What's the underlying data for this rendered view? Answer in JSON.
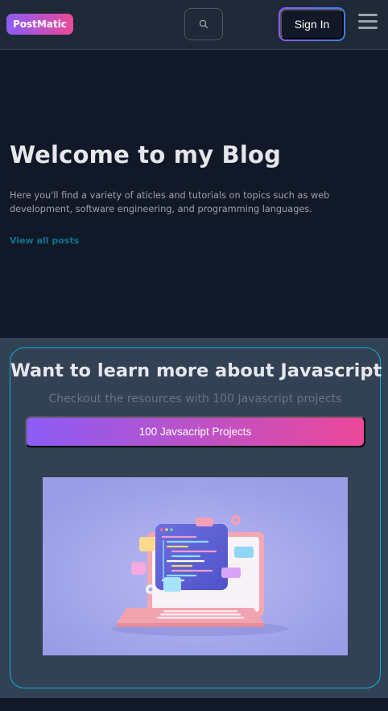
{
  "navbar": {
    "logo_text": "PostMatic",
    "search_icon": "search-icon",
    "signin_label": "Sign In",
    "menu_icon": "hamburger-menu-icon"
  },
  "hero": {
    "title": "Welcome to my Blog",
    "description": "Here you'll find a variety of aticles and tutorials on topics such as web development, software engineering, and programming languages.",
    "link_label": "View all posts"
  },
  "promo": {
    "title": "Want to learn more about Javascript",
    "subtitle": "Checkout the resources with 100 Javascript projects",
    "button_label": "100 Javsacript Projects",
    "image": "laptop-code-illustration"
  },
  "colors": {
    "page_bg": "#111827",
    "navbar_bg": "#1f2937",
    "section_bg": "#334155",
    "accent_start": "#8b5cf6",
    "accent_end": "#ec4899",
    "link": "#0e7490",
    "card_border": "#06b6d4"
  }
}
